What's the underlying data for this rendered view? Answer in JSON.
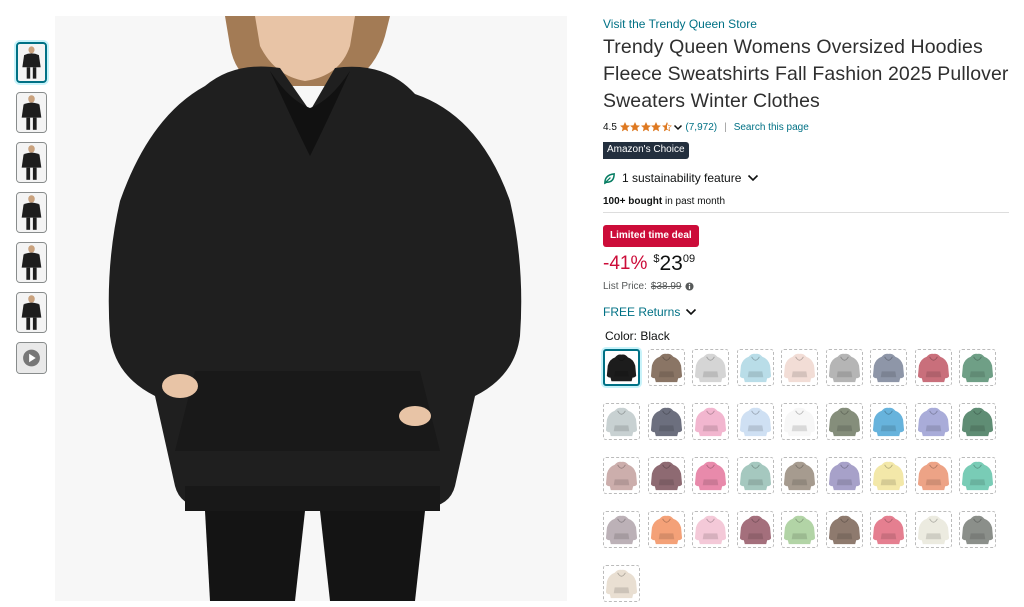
{
  "store": {
    "link_text": "Visit the Trendy Queen Store"
  },
  "product": {
    "title": "Trendy Queen Womens Oversized Hoodies Fleece Sweatshirts Fall Fashion 2025 Pullover Sweaters Winter Clothes",
    "rating_value": "4.5",
    "rating_stars": 4.5,
    "rating_count": "(7,972)",
    "search_link": "Search this page",
    "choice_badge_prefix": "Amazon's",
    "choice_badge_accent": "Choice",
    "sustainability": "1 sustainability feature",
    "bought_bold": "100+ bought",
    "bought_rest": "in past month",
    "deal_badge": "Limited time deal",
    "discount": "-41%",
    "price_symbol": "$",
    "price_whole": "23",
    "price_fraction": "09",
    "list_price_label": "List Price:",
    "list_price_value": "$38.99",
    "returns": "FREE Returns",
    "color_label": "Color: Black"
  },
  "icons": {
    "share": "share-icon",
    "leaf": "leaf-icon",
    "chevron": "chevron-down-icon",
    "info": "info-icon",
    "play": "play-icon",
    "star": "star-icon"
  },
  "colors": {
    "link": "#007185",
    "deal": "#cc0c39",
    "star": "#de7921",
    "choice_bg": "#232f3e",
    "choice_accent": "#ff9900"
  },
  "thumbnails": [
    {
      "type": "image",
      "color": "#1e1e1e",
      "selected": true
    },
    {
      "type": "image",
      "color": "#1e1e1e"
    },
    {
      "type": "image",
      "color": "#1e1e1e"
    },
    {
      "type": "image",
      "color": "#1e1e1e"
    },
    {
      "type": "image",
      "color": "#1e1e1e"
    },
    {
      "type": "image",
      "color": "#1e1e1e"
    },
    {
      "type": "video",
      "color": "#777777"
    }
  ],
  "swatches": [
    "#1c1c1c",
    "#8a7565",
    "#d5d5d5",
    "#b9dde8",
    "#f2ddd6",
    "#b5b5b5",
    "#8e96a8",
    "#c96f7b",
    "#6f9f86",
    "#c8d1d2",
    "#6c6f7e",
    "#f2b6cf",
    "#cfe0f3",
    "#f7f7f7",
    "#858e7b",
    "#67b3dc",
    "#a9acd9",
    "#5f8d74",
    "#ccaeac",
    "#8e6a72",
    "#e88aab",
    "#a5c8bf",
    "#a69b8f",
    "#a7a1c9",
    "#f3e8a9",
    "#eda386",
    "#79ccb6",
    "#bcb1b7",
    "#f4a178",
    "#f4c9d8",
    "#a46f7c",
    "#b2d4a6",
    "#8e7a6e",
    "#e57f90",
    "#ecebe0",
    "#8b8f8a",
    "#e9dfd2"
  ]
}
